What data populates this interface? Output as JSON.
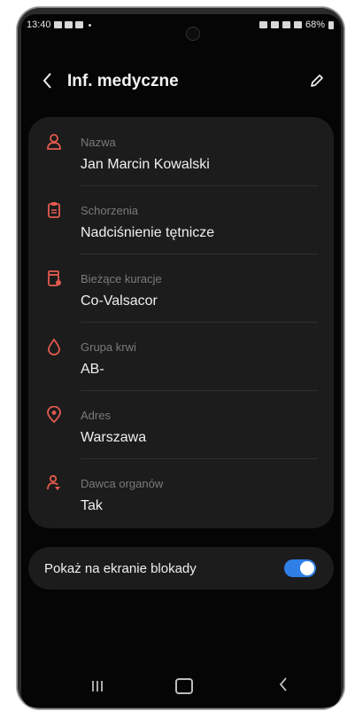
{
  "status_bar": {
    "time": "13:40",
    "battery": "68%"
  },
  "app_bar": {
    "back_icon": "chevron-left-icon",
    "title": "Inf. medyczne",
    "edit_icon": "pencil-icon"
  },
  "fields": [
    {
      "icon": "person-icon",
      "label": "Nazwa",
      "value": "Jan Marcin Kowalski"
    },
    {
      "icon": "clipboard-icon",
      "label": "Schorzenia",
      "value": "Nadciśnienie tętnicze"
    },
    {
      "icon": "pill-bottle-icon",
      "label": "Bieżące kuracje",
      "value": "Co-Valsacor"
    },
    {
      "icon": "blood-drop-icon",
      "label": "Grupa krwi",
      "value": "AB-"
    },
    {
      "icon": "location-pin-icon",
      "label": "Adres",
      "value": "Warszawa"
    },
    {
      "icon": "organ-donor-icon",
      "label": "Dawca organów",
      "value": "Tak"
    }
  ],
  "lock_screen_toggle": {
    "label": "Pokaż na ekranie blokady",
    "enabled": true
  },
  "colors": {
    "accent_icon": "#e45a4e",
    "toggle_on": "#2f7fe6",
    "background": "#050505",
    "card": "#1c1c1c"
  }
}
